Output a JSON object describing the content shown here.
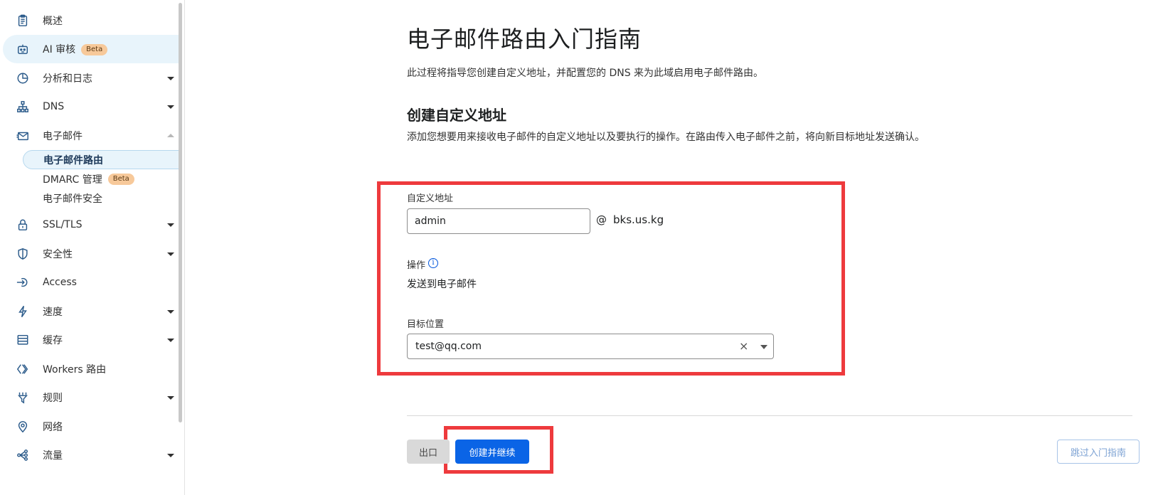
{
  "sidebar": {
    "items": [
      {
        "id": "overview",
        "label": "概述",
        "icon": "clipboard-icon",
        "has_caret": false
      },
      {
        "id": "ai-audit",
        "label": "AI 审核",
        "icon": "robot-icon",
        "badge": "Beta",
        "has_caret": false
      },
      {
        "id": "analytics",
        "label": "分析和日志",
        "icon": "pie-chart-icon",
        "has_caret": true
      },
      {
        "id": "dns",
        "label": "DNS",
        "icon": "network-tree-icon",
        "has_caret": true
      },
      {
        "id": "email",
        "label": "电子邮件",
        "icon": "envelope-icon",
        "has_caret": true,
        "expanded": true
      },
      {
        "id": "ssl",
        "label": "SSL/TLS",
        "icon": "lock-icon",
        "has_caret": true
      },
      {
        "id": "security",
        "label": "安全性",
        "icon": "shield-icon",
        "has_caret": true
      },
      {
        "id": "access",
        "label": "Access",
        "icon": "access-arrow-icon",
        "has_caret": false
      },
      {
        "id": "speed",
        "label": "速度",
        "icon": "lightning-icon",
        "has_caret": true
      },
      {
        "id": "cache",
        "label": "缓存",
        "icon": "storage-icon",
        "has_caret": true
      },
      {
        "id": "workers",
        "label": "Workers 路由",
        "icon": "code-brackets-icon",
        "has_caret": false
      },
      {
        "id": "rules",
        "label": "规则",
        "icon": "funnel-icon",
        "has_caret": true
      },
      {
        "id": "network",
        "label": "网络",
        "icon": "location-pin-icon",
        "has_caret": false
      },
      {
        "id": "traffic",
        "label": "流量",
        "icon": "share-nodes-icon",
        "has_caret": true
      }
    ],
    "email_sub_items": [
      {
        "label": "电子邮件路由",
        "selected": true
      },
      {
        "label": "DMARC 管理",
        "badge": "Beta"
      },
      {
        "label": "电子邮件安全"
      }
    ]
  },
  "main": {
    "title": "电子邮件路由入门指南",
    "description": "此过程将指导您创建自定义地址，并配置您的 DNS 来为此域启用电子邮件路由。",
    "section_title": "创建自定义地址",
    "section_description": "添加您想要用来接收电子邮件的自定义地址以及要执行的操作。在路由传入电子邮件之前，将向新目标地址发送确认。",
    "custom_address": {
      "label": "自定义地址",
      "value": "admin",
      "at": "@",
      "domain": "bks.us.kg"
    },
    "action": {
      "label": "操作",
      "info_icon": "info-icon",
      "value": "发送到电子邮件"
    },
    "destination": {
      "label": "目标位置",
      "value": "test@qq.com",
      "clear_icon": "close-icon"
    },
    "buttons": {
      "exit": "出口",
      "create_continue": "创建并继续",
      "skip_guide": "跳过入门指南"
    }
  },
  "colors": {
    "highlight": "#ee3a3d",
    "primary": "#0a64e6",
    "badge": "#f7c99a"
  }
}
